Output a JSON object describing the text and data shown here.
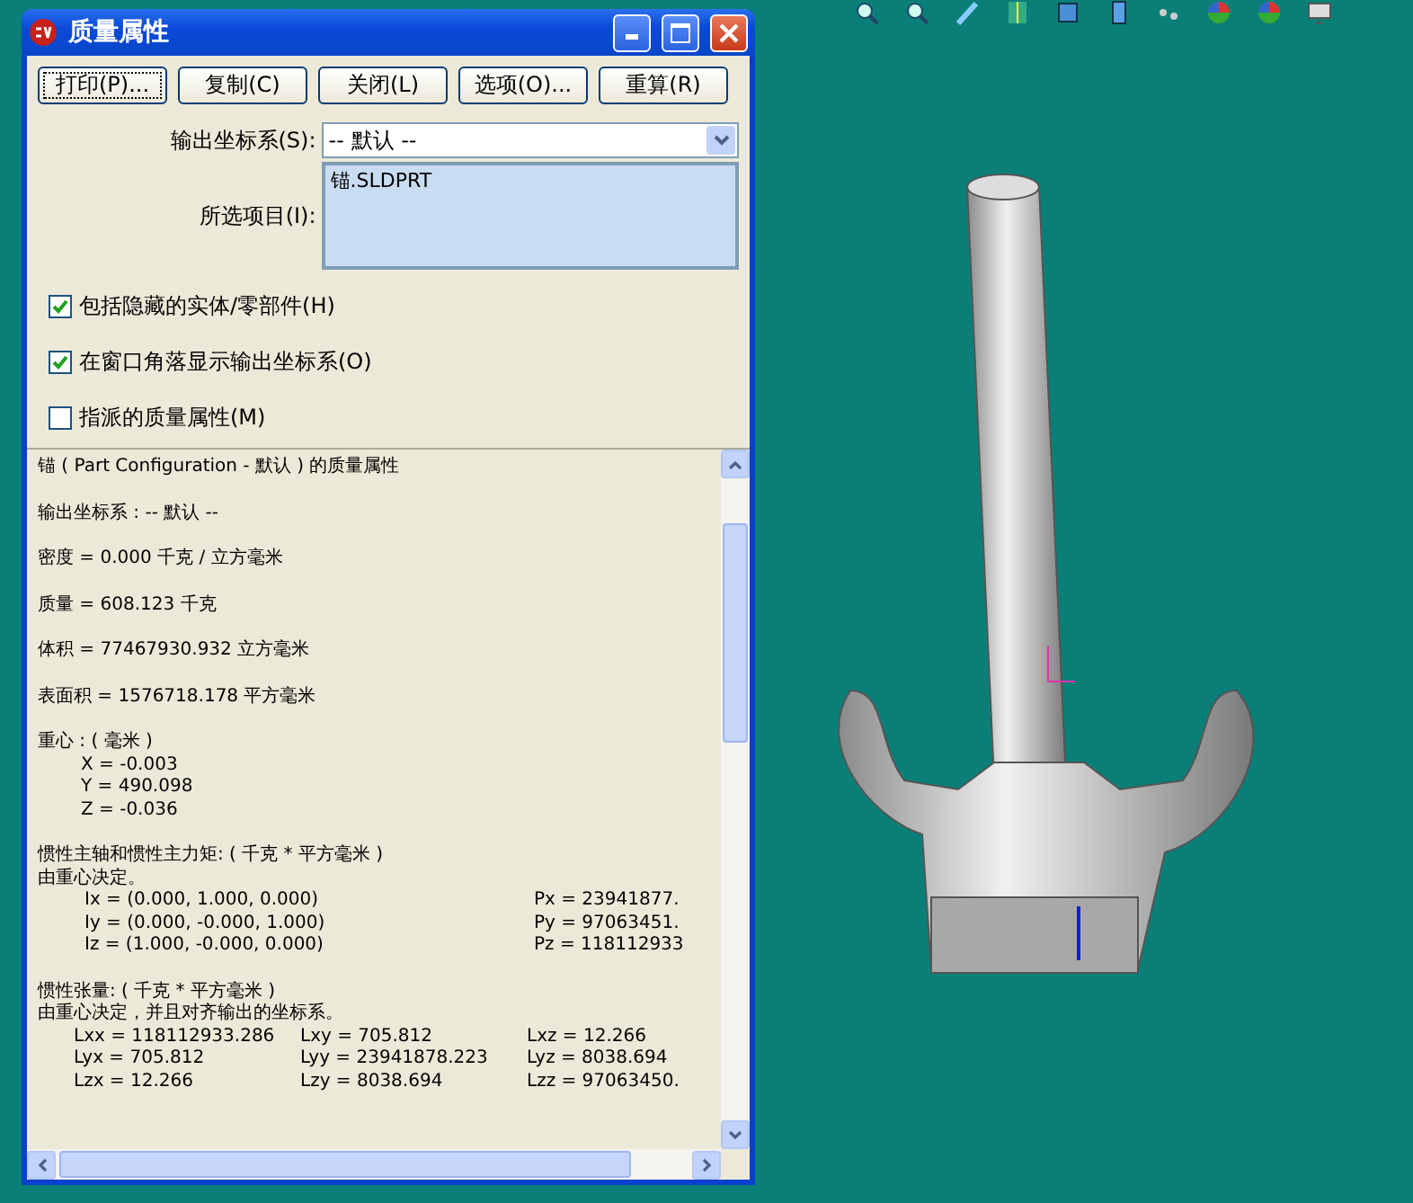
{
  "window": {
    "title": "质量属性"
  },
  "buttons": [
    {
      "label": "打印(P)...",
      "selected": true
    },
    {
      "label": "复制(C)",
      "selected": false
    },
    {
      "label": "关闭(L)",
      "selected": false
    },
    {
      "label": "选项(O)...",
      "selected": false
    },
    {
      "label": "重算(R)",
      "selected": false
    }
  ],
  "output_coordinate_system": {
    "label": "输出坐标系(S):",
    "value": "-- 默认 --"
  },
  "selected_items": {
    "label": "所选项目(I):",
    "items": [
      "锚.SLDPRT"
    ]
  },
  "options": [
    {
      "label": "包括隐藏的实体/零部件(H)",
      "checked": true
    },
    {
      "label": "在窗口角落显示输出坐标系(O)",
      "checked": true
    },
    {
      "label": "指派的质量属性(M)",
      "checked": false
    }
  ],
  "report": [
    {
      "lines": [
        {
          "kind": "text",
          "text": "锚 ( Part Configuration - 默认 ) 的质量属性"
        }
      ]
    },
    {
      "lines": [
        {
          "kind": "text",
          "text": "输出坐标系 : -- 默认 --"
        }
      ]
    },
    {
      "lines": [
        {
          "kind": "text",
          "text": "密度 = 0.000 千克 /  立方毫米"
        }
      ]
    },
    {
      "lines": [
        {
          "kind": "text",
          "text": "质量 = 608.123 千克"
        }
      ]
    },
    {
      "lines": [
        {
          "kind": "text",
          "text": "体积 = 77467930.932  立方毫米"
        }
      ]
    },
    {
      "lines": [
        {
          "kind": "text",
          "text": "表面积 = 1576718.178  平方毫米"
        }
      ]
    },
    {
      "lines": [
        {
          "kind": "text",
          "text": "重心 : ( 毫米 )"
        },
        {
          "kind": "indent",
          "text": "X = -0.003"
        },
        {
          "kind": "indent",
          "text": "Y = 490.098"
        },
        {
          "kind": "indent",
          "text": "Z = -0.036"
        }
      ]
    },
    {
      "lines": [
        {
          "kind": "text",
          "text": "惯性主轴和惯性主力矩: ( 千克 *  平方毫米 )"
        },
        {
          "kind": "text",
          "text": "由重心决定。"
        },
        {
          "kind": "pair",
          "cells": [
            "Ix = (0.000, 1.000, 0.000)",
            "Px = 23941877."
          ]
        },
        {
          "kind": "pair",
          "cells": [
            "Iy = (0.000, -0.000, 1.000)",
            "Py = 97063451."
          ]
        },
        {
          "kind": "pair",
          "cells": [
            "Iz = (1.000, -0.000, 0.000)",
            "Pz = 118112933"
          ]
        }
      ]
    },
    {
      "lines": [
        {
          "kind": "text",
          "text": "惯性张量: ( 千克 *  平方毫米 )"
        },
        {
          "kind": "text",
          "text": "由重心决定，并且对齐输出的坐标系。"
        },
        {
          "kind": "triple",
          "cells": [
            "Lxx = 118112933.286",
            "Lxy = 705.812",
            "Lxz = 12.266"
          ]
        },
        {
          "kind": "triple",
          "cells": [
            "Lyx = 705.812",
            "Lyy = 23941878.223",
            "Lyz = 8038.694"
          ]
        },
        {
          "kind": "triple",
          "cells": [
            "Lzx = 12.266",
            "Lzy = 8038.694",
            "Lzz = 97063450."
          ]
        }
      ]
    }
  ]
}
